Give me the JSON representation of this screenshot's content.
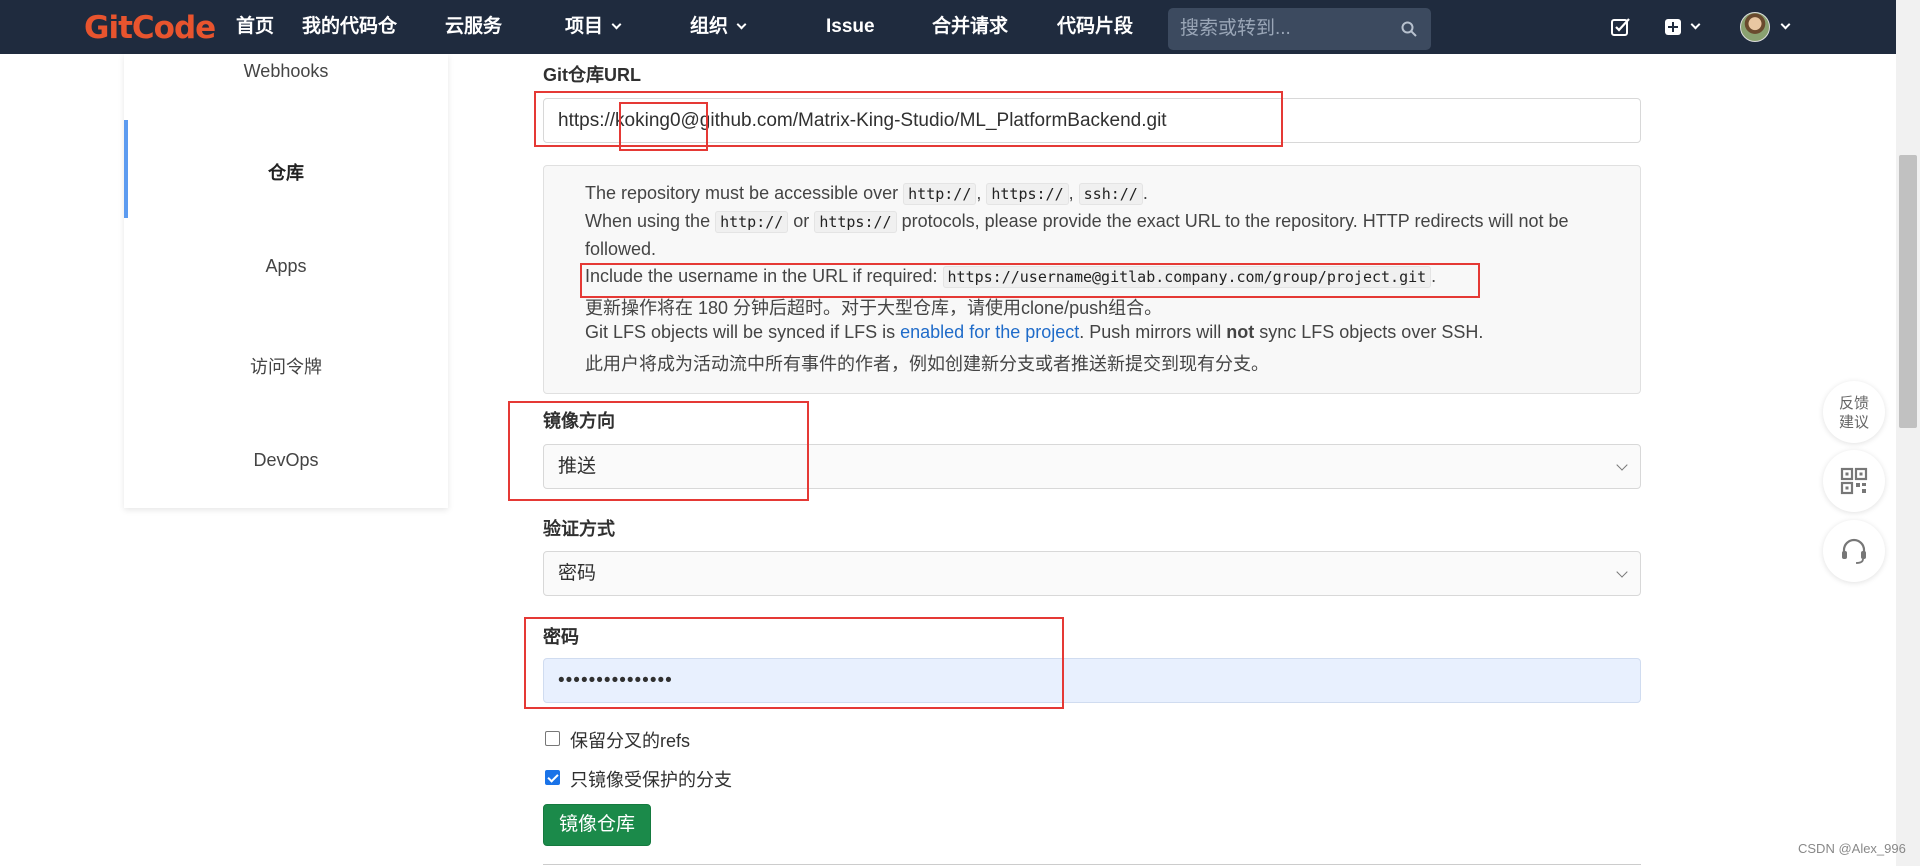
{
  "nav": {
    "logo": "GitCode",
    "items": [
      "首页",
      "我的代码仓",
      "云服务",
      "项目",
      "组织",
      "Issue",
      "合并请求",
      "代码片段"
    ],
    "search_placeholder": "搜索或转到..."
  },
  "sidebar": {
    "items": [
      "Webhooks",
      "仓库",
      "Apps",
      "访问令牌",
      "DevOps"
    ],
    "active": "仓库"
  },
  "form": {
    "url_label": "Git仓库URL",
    "url_value": "https://koking0@github.com/Matrix-King-Studio/ML_PlatformBackend.git",
    "help": {
      "l1_a": "The repository must be accessible over ",
      "l1_c1": "http://",
      "l1_sep1": ", ",
      "l1_c2": "https://",
      "l1_sep2": ", ",
      "l1_c3": "ssh://",
      "l1_end": ".",
      "l2_a": "When using the ",
      "l2_c1": "http://",
      "l2_or": " or ",
      "l2_c2": "https://",
      "l2_b": " protocols, please provide the exact URL to the repository. HTTP redirects will not be",
      "l3": "followed.",
      "l4_a": "Include the username in the URL if required: ",
      "l4_code": "https://username@gitlab.company.com/group/project.git",
      "l4_end": ".",
      "l5": "更新操作将在 180 分钟后超时。对于大型仓库，请使用clone/push组合。",
      "l6_a": "Git LFS objects will be synced if LFS is ",
      "l6_link": "enabled for the project",
      "l6_b": ". Push mirrors will ",
      "l6_bold": "not",
      "l6_c": " sync LFS objects over SSH.",
      "l7": "此用户将成为活动流中所有事件的作者，例如创建新分支或者推送新提交到现有分支。"
    },
    "direction_label": "镜像方向",
    "direction_value": "推送",
    "auth_label": "验证方式",
    "auth_value": "密码",
    "password_label": "密码",
    "password_value": "•••••••••••••••",
    "keep_refs_label": "保留分叉的refs",
    "keep_refs_checked": false,
    "protected_only_label": "只镜像受保护的分支",
    "protected_only_checked": true,
    "submit_label": "镜像仓库"
  },
  "float": {
    "feedback": "反馈\n建议"
  },
  "watermark": "CSDN @Alex_996",
  "colors": {
    "nav_bg": "#1f2b3e",
    "brand": "#e8542e",
    "button_green": "#1b8a4a",
    "highlight_red": "#e53935",
    "sidebar_accent": "#5c9bf0"
  }
}
